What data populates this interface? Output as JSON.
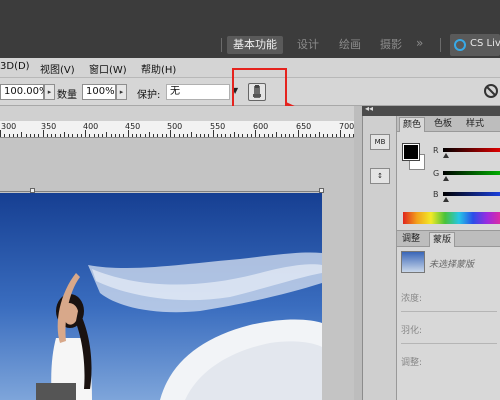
{
  "workspace": {
    "items": [
      "基本功能",
      "设计",
      "绘画",
      "摄影"
    ],
    "more": "»",
    "cs_live": "CS Liv"
  },
  "menu": {
    "items": [
      "3D(D)",
      "视图(V)",
      "窗口(W)",
      "帮助(H)"
    ]
  },
  "options": {
    "opacity_value": "100.00%",
    "flow_label": "数量",
    "flow_value": "100%",
    "protect_label": "保护:",
    "protect_value": "无",
    "spin_arrow": "▸",
    "dropdown_arrow": "▼"
  },
  "ruler": {
    "labels": [
      "300",
      "350",
      "400",
      "450",
      "500",
      "550",
      "600",
      "650",
      "700"
    ]
  },
  "panels": {
    "collapse_glyph": "◂◂",
    "color_tabs": [
      "颜色",
      "色板",
      "样式"
    ],
    "channels": [
      "R",
      "G",
      "B"
    ],
    "mask_tabs": [
      "调整",
      "蒙版"
    ],
    "mask_note": "未选择蒙版",
    "mask_labels": [
      "浓度:",
      "羽化:",
      "调整:"
    ],
    "side_icons": [
      "MB",
      "↕"
    ]
  },
  "colors": {
    "foreground": "#000000",
    "background": "#ffffff",
    "highlight": "#e5231e"
  }
}
